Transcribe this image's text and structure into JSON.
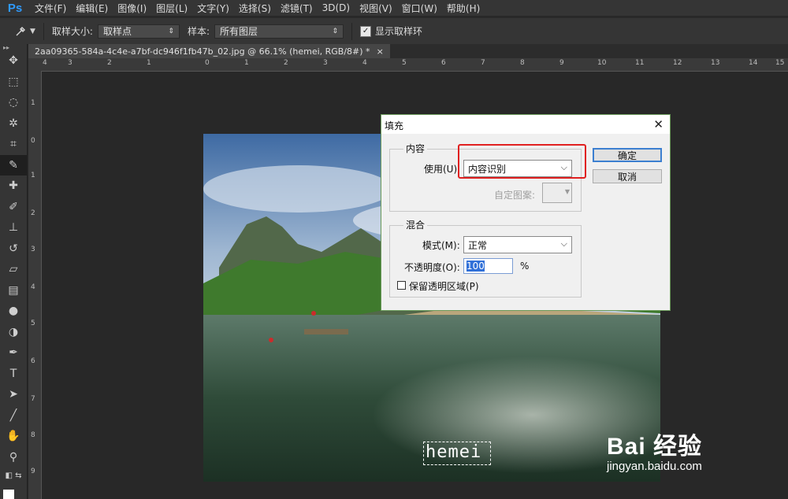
{
  "app": {
    "logo": "Ps"
  },
  "menu": [
    "文件(F)",
    "编辑(E)",
    "图像(I)",
    "图层(L)",
    "文字(Y)",
    "选择(S)",
    "滤镜(T)",
    "3D(D)",
    "视图(V)",
    "窗口(W)",
    "帮助(H)"
  ],
  "options": {
    "sample_size_label": "取样大小:",
    "sample_size_value": "取样点",
    "sample_label": "样本:",
    "sample_value": "所有图层",
    "show_ring_label": "显示取样环",
    "show_ring_checked": true
  },
  "document": {
    "tab_title": "2aa09365-584a-4c4e-a7bf-dc946f1fb47b_02.jpg @ 66.1% (hemei, RGB/8#) *",
    "close": "×"
  },
  "rulers": {
    "h": [
      "4",
      "3",
      "2",
      "1",
      "0",
      "1",
      "2",
      "3",
      "4",
      "5",
      "6",
      "7",
      "8",
      "9",
      "10",
      "11",
      "12",
      "13",
      "14",
      "15"
    ],
    "v": [
      "1",
      "0",
      "1",
      "2",
      "3",
      "4",
      "5",
      "6",
      "7",
      "8",
      "9"
    ]
  },
  "canvas": {
    "selection_text": "hemei"
  },
  "dialog": {
    "title": "填充",
    "close": "✕",
    "content_group": "内容",
    "use_label": "使用(U):",
    "use_value": "内容识别",
    "pattern_label": "自定图案:",
    "blend_group": "混合",
    "mode_label": "模式(M):",
    "mode_value": "正常",
    "opacity_label": "不透明度(O):",
    "opacity_value": "100",
    "opacity_unit": "%",
    "preserve_label": "保留透明区域(P)",
    "preserve_checked": false,
    "ok_label": "确定",
    "cancel_label": "取消"
  },
  "watermark": {
    "main": "Bai 经验",
    "sub": "jingyan.baidu.com"
  },
  "colors": {
    "highlight": "#e02020",
    "default_button": "#3c7fd0",
    "ps_blue": "#2f9bff"
  }
}
